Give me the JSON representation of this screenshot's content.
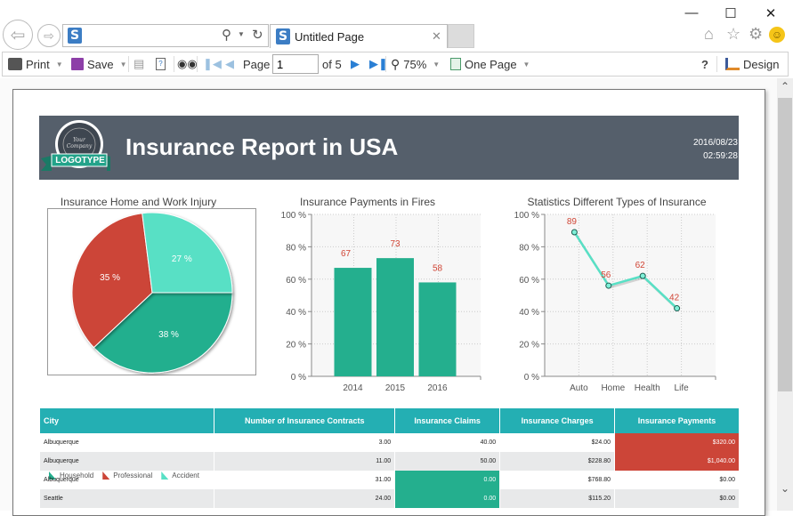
{
  "browser": {
    "address_value": "",
    "tab_title": "Untitled Page",
    "window_controls": [
      "minimize",
      "maximize",
      "close"
    ],
    "right_icons": [
      "home-icon",
      "star-icon",
      "gear-icon",
      "smiley-icon"
    ]
  },
  "toolbar": {
    "print_label": "Print",
    "save_label": "Save",
    "page_label": "Page",
    "page_value": "1",
    "page_of": "of 5",
    "zoom_label": "75%",
    "view_mode_label": "One Page",
    "help_label": "?",
    "design_label": "Design"
  },
  "report": {
    "logo_text": "LOGOTYPE",
    "logo_script": "Your Company",
    "title": "Insurance Report in USA",
    "date": "2016/08/23",
    "time": "02:59:28",
    "colors": {
      "banner": "#555f6b",
      "teal": "#24afb3",
      "green": "#24af8e",
      "red": "#cc4538",
      "mint": "#58e0c5"
    }
  },
  "chart_data": [
    {
      "type": "pie",
      "title": "Insurance Home and Work Injury",
      "categories": [
        "Household",
        "Professional",
        "Accident"
      ],
      "values": [
        38,
        35,
        27
      ],
      "labels": [
        "38 %",
        "35 %",
        "27 %"
      ],
      "colors": [
        "#24af8e",
        "#cc4538",
        "#58e0c5"
      ],
      "legend": "bottom-left"
    },
    {
      "type": "bar",
      "title": "Insurance Payments in Fires",
      "categories": [
        "2014",
        "2015",
        "2016"
      ],
      "values": [
        67,
        73,
        58
      ],
      "ylim": [
        0,
        100
      ],
      "yticks": [
        "0 %",
        "20 %",
        "40 %",
        "60 %",
        "80 %",
        "100 %"
      ],
      "grid": true,
      "color": "#24af8e"
    },
    {
      "type": "line",
      "title": "Statistics Different Types of Insurance",
      "categories": [
        "Auto",
        "Home",
        "Health",
        "Life"
      ],
      "values": [
        89,
        56,
        62,
        42
      ],
      "ylim": [
        0,
        100
      ],
      "yticks": [
        "0 %",
        "20 %",
        "40 %",
        "60 %",
        "80 %",
        "100 %"
      ],
      "grid": true,
      "color": "#58e0c5"
    }
  ],
  "table": {
    "headers": [
      "City",
      "Number of Insurance Contracts",
      "Insurance Claims",
      "Insurance Charges",
      "Insurance Payments"
    ],
    "rows": [
      [
        "Albuquerque",
        "3.00",
        "40.00",
        "$24.00",
        "$320.00"
      ],
      [
        "Albuquerque",
        "11.00",
        "50.00",
        "$228.80",
        "$1,040.00"
      ],
      [
        "Albuquerque",
        "31.00",
        "0.00",
        "$768.80",
        "$0.00"
      ],
      [
        "Seattle",
        "24.00",
        "0.00",
        "$115.20",
        "$0.00"
      ]
    ]
  }
}
